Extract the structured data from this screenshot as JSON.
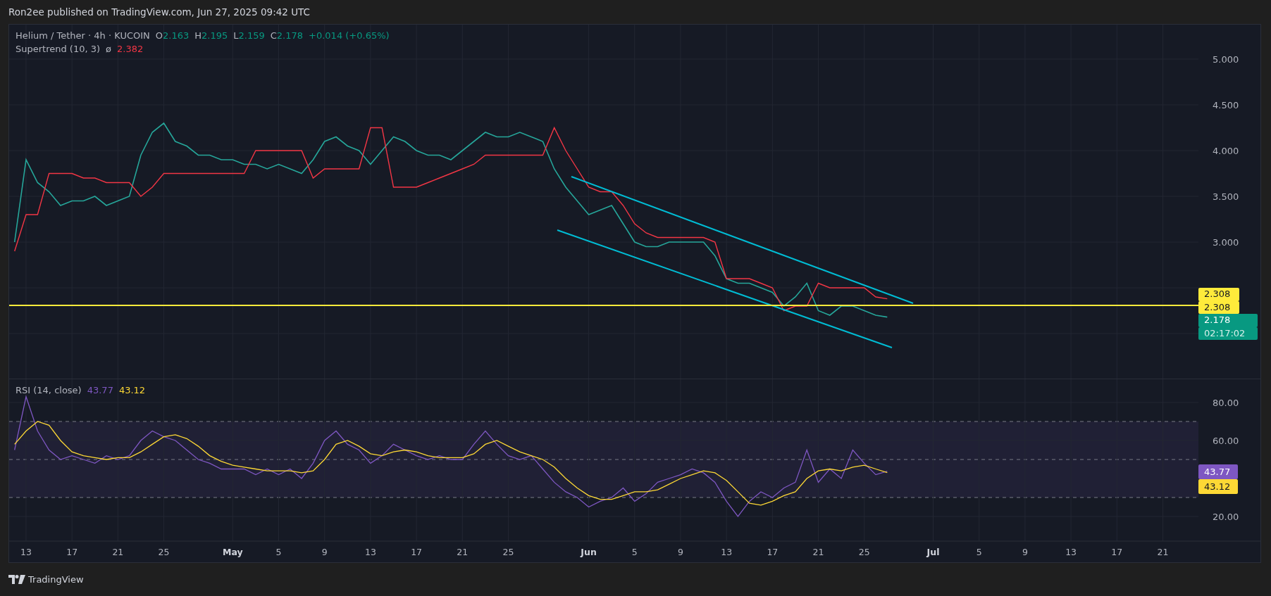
{
  "header": {
    "publisher": "Ron2ee published on TradingView.com, Jun 27, 2025 09:42 UTC"
  },
  "price_pane": {
    "legend": {
      "symbol": "Helium / Tether · 4h · KUCOIN",
      "ohlc": [
        {
          "label": "O",
          "value": "2.163"
        },
        {
          "label": "H",
          "value": "2.195"
        },
        {
          "label": "L",
          "value": "2.159"
        },
        {
          "label": "C",
          "value": "2.178"
        }
      ],
      "change": "+0.014 (+0.65%)"
    },
    "indicator": {
      "name": "Supertrend (10, 3)",
      "symbol": "ø",
      "value": "2.382"
    },
    "badges": [
      {
        "kind": "line_level",
        "text": "2.308"
      },
      {
        "kind": "line_level",
        "text": "2.308"
      },
      {
        "kind": "last_price",
        "text": "2.178"
      },
      {
        "kind": "countdown",
        "text": "02:17:02"
      }
    ],
    "chart_data": {
      "type": "line",
      "categories": [
        null,
        null,
        null,
        null,
        null,
        null,
        null,
        null,
        null,
        null,
        null,
        null,
        null,
        null,
        null,
        null,
        null,
        null,
        null,
        null,
        null,
        null,
        null,
        null,
        null,
        null,
        null,
        null,
        null,
        null,
        null,
        null,
        null,
        null,
        null,
        null,
        null,
        null,
        null,
        null,
        null,
        null,
        null,
        null,
        null,
        null,
        null,
        null,
        null,
        null,
        null,
        null,
        null,
        null,
        null,
        null,
        null,
        null,
        null,
        null,
        null,
        null,
        null,
        null,
        null,
        null,
        null,
        null,
        null,
        null,
        null,
        null,
        null,
        null,
        null,
        null,
        null,
        null,
        null,
        null,
        null,
        null,
        null,
        null,
        null,
        null,
        null,
        null,
        null,
        null,
        null,
        null,
        null,
        null,
        null,
        null,
        null,
        null,
        null,
        null,
        null,
        null,
        null
      ],
      "series": [
        {
          "color": "#26a69a",
          "values": [
            3.0,
            3.9,
            3.65,
            3.55,
            3.4,
            3.45,
            3.45,
            3.5,
            3.4,
            3.45,
            3.5,
            3.95,
            4.2,
            4.3,
            4.1,
            4.05,
            3.95,
            3.95,
            3.9,
            3.9,
            3.85,
            3.85,
            3.8,
            3.85,
            3.8,
            3.75,
            3.9,
            4.1,
            4.15,
            4.05,
            4.0,
            3.85,
            4.0,
            4.15,
            4.1,
            4.0,
            3.95,
            3.95,
            3.9,
            4.0,
            4.1,
            4.2,
            4.15,
            4.15,
            4.2,
            4.15,
            4.1,
            3.8,
            3.6,
            3.45,
            3.3,
            3.35,
            3.4,
            3.2,
            3.0,
            2.95,
            2.95,
            3.0,
            3.0,
            3.0,
            3.0,
            2.85,
            2.6,
            2.55,
            2.55,
            2.5,
            2.45,
            2.3,
            2.4,
            2.55,
            2.25,
            2.2,
            2.3,
            2.3,
            2.25,
            2.2,
            2.18,
            null,
            null,
            null,
            null,
            null,
            null,
            null,
            null,
            null,
            null,
            null,
            null,
            null,
            null,
            null,
            null,
            null,
            null,
            null,
            null,
            null,
            null,
            null,
            null,
            null,
            null
          ]
        },
        {
          "color": "#f23645",
          "values": [
            2.9,
            3.3,
            3.3,
            3.75,
            3.75,
            3.75,
            3.7,
            3.7,
            3.65,
            3.65,
            3.65,
            3.5,
            3.6,
            3.75,
            3.75,
            3.75,
            3.75,
            3.75,
            3.75,
            3.75,
            3.75,
            4.0,
            4.0,
            4.0,
            4.0,
            4.0,
            3.7,
            3.8,
            3.8,
            3.8,
            3.8,
            4.25,
            4.25,
            3.6,
            3.6,
            3.6,
            3.65,
            3.7,
            3.75,
            3.8,
            3.85,
            3.95,
            3.95,
            3.95,
            3.95,
            3.95,
            3.95,
            4.25,
            4.0,
            3.8,
            3.6,
            3.55,
            3.55,
            3.4,
            3.2,
            3.1,
            3.05,
            3.05,
            3.05,
            3.05,
            3.05,
            3.0,
            2.6,
            2.6,
            2.6,
            2.55,
            2.5,
            2.25,
            2.3,
            2.3,
            2.55,
            2.5,
            2.5,
            2.5,
            2.5,
            2.4,
            2.38,
            null,
            null,
            null,
            null,
            null,
            null,
            null,
            null,
            null,
            null,
            null,
            null,
            null,
            null,
            null,
            null,
            null,
            null,
            null,
            null,
            null,
            null,
            null,
            null,
            null,
            null
          ]
        }
      ],
      "ylim": [
        1.508,
        5.377
      ],
      "grid": true,
      "yticks": [
        {
          "value": 3,
          "label": "3.000"
        },
        {
          "value": 3.5,
          "label": "3.500"
        },
        {
          "value": 4,
          "label": "4.000"
        },
        {
          "value": 4.5,
          "label": "4.500"
        },
        {
          "value": 5,
          "label": "5.000"
        }
      ]
    }
  },
  "rsi_pane": {
    "legend": {
      "name": "RSI (14, close)",
      "values": [
        {
          "kind": "rsi",
          "text": "43.77"
        },
        {
          "kind": "ma",
          "text": "43.12"
        }
      ]
    },
    "badges": [
      {
        "kind": "rsi",
        "text": "43.77"
      },
      {
        "kind": "ma",
        "text": "43.12"
      }
    ],
    "chart_data": {
      "type": "line",
      "categories": [
        null,
        "13",
        null,
        null,
        null,
        "17",
        null,
        null,
        null,
        "21",
        null,
        null,
        null,
        "25",
        null,
        null,
        null,
        null,
        null,
        "May",
        null,
        null,
        null,
        "5",
        null,
        null,
        null,
        "9",
        null,
        null,
        null,
        "13",
        null,
        null,
        null,
        "17",
        null,
        null,
        null,
        "21",
        null,
        null,
        null,
        "25",
        null,
        null,
        null,
        null,
        null,
        null,
        "Jun",
        null,
        null,
        null,
        "5",
        null,
        null,
        null,
        "9",
        null,
        null,
        null,
        "13",
        null,
        null,
        null,
        "17",
        null,
        null,
        null,
        "21",
        null,
        null,
        null,
        "25",
        null,
        null,
        null,
        null,
        null,
        "Jul",
        null,
        null,
        null,
        "5",
        null,
        null,
        null,
        "9",
        null,
        null,
        null,
        "13",
        null,
        null,
        null,
        "17",
        null,
        null,
        null,
        "21",
        null,
        null
      ],
      "series": [
        {
          "color": "#7e57c2",
          "values": [
            55,
            83,
            65,
            55,
            50,
            52,
            50,
            48,
            52,
            50,
            52,
            60,
            65,
            62,
            60,
            55,
            50,
            48,
            45,
            45,
            45,
            42,
            45,
            42,
            45,
            40,
            48,
            60,
            65,
            58,
            55,
            48,
            52,
            58,
            55,
            52,
            50,
            52,
            50,
            50,
            58,
            65,
            58,
            52,
            50,
            52,
            45,
            38,
            33,
            30,
            25,
            28,
            30,
            35,
            28,
            32,
            38,
            40,
            42,
            45,
            43,
            38,
            28,
            20,
            28,
            33,
            30,
            35,
            38,
            55,
            38,
            45,
            40,
            55,
            48,
            42,
            43.8,
            null,
            null,
            null,
            null,
            null,
            null,
            null,
            null,
            null,
            null,
            null,
            null,
            null,
            null,
            null,
            null,
            null,
            null,
            null,
            null,
            null,
            null,
            null,
            null,
            null,
            null
          ]
        },
        {
          "color": "#fdd835",
          "values": [
            58,
            65,
            70,
            68,
            60,
            54,
            52,
            51,
            50,
            51,
            51,
            54,
            58,
            62,
            63,
            61,
            57,
            52,
            49,
            47,
            46,
            45,
            44,
            44,
            44,
            43,
            44,
            50,
            58,
            60,
            57,
            53,
            52,
            54,
            55,
            54,
            52,
            51,
            51,
            51,
            53,
            58,
            60,
            57,
            54,
            52,
            50,
            46,
            40,
            35,
            31,
            29,
            29,
            31,
            33,
            33,
            34,
            37,
            40,
            42,
            44,
            43,
            39,
            33,
            27,
            26,
            28,
            31,
            33,
            40,
            44,
            45,
            44,
            46,
            47,
            45,
            43.1,
            null,
            null,
            null,
            null,
            null,
            null,
            null,
            null,
            null,
            null,
            null,
            null,
            null,
            null,
            null,
            null,
            null,
            null,
            null,
            null,
            null,
            null,
            null,
            null,
            null,
            null
          ]
        }
      ],
      "ylim": [
        7.04,
        92.2
      ],
      "grid": true,
      "yticks": [
        {
          "value": 20,
          "label": "20.00"
        },
        {
          "value": 60,
          "label": "60.00"
        },
        {
          "value": 80,
          "label": "80.00"
        }
      ]
    }
  },
  "footer": {
    "brand": "TradingView"
  }
}
